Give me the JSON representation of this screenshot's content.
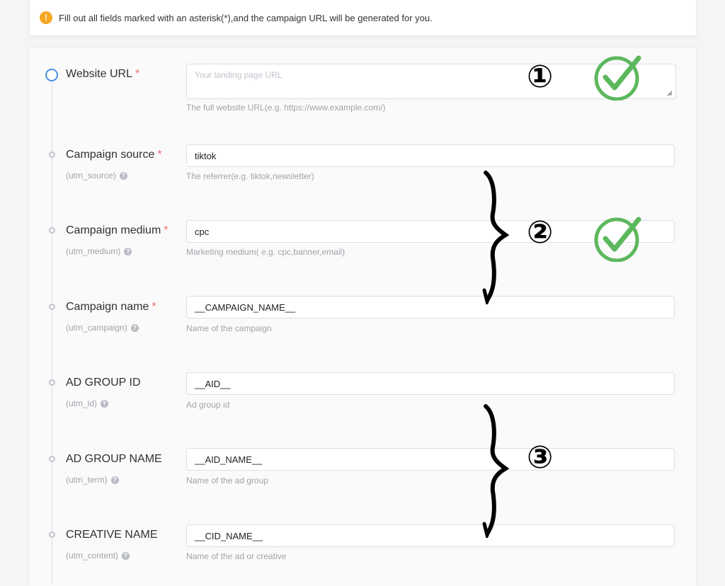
{
  "notice": {
    "icon": "exclamation-icon",
    "text": "Fill out all fields marked with an asterisk(*),and the campaign URL will be generated for you."
  },
  "fields": [
    {
      "label": "Website URL",
      "required": "*",
      "param": "",
      "value": "",
      "placeholder": "Your landing page URL",
      "hint": "The full website URL(e.g. https://www.example.com/)"
    },
    {
      "label": "Campaign source",
      "required": "*",
      "param": "(utm_source)",
      "value": "tiktok",
      "hint": "The referrer(e.g. tiktok,newsletter)"
    },
    {
      "label": "Campaign medium",
      "required": "*",
      "param": "(utm_medium)",
      "value": "cpc",
      "hint": "Marketing medium( e.g. cpc,banner,email)"
    },
    {
      "label": "Campaign name",
      "required": "*",
      "param": "(utm_campaign)",
      "value": "__CAMPAIGN_NAME__",
      "hint": "Name of the campaign"
    },
    {
      "label": "AD GROUP ID",
      "required": "",
      "param": "(utm_id)",
      "value": "__AID__",
      "hint": "Ad group id"
    },
    {
      "label": "AD GROUP NAME",
      "required": "",
      "param": "(utm_term)",
      "value": "__AID_NAME__",
      "hint": "Name of the ad group"
    },
    {
      "label": "CREATIVE NAME",
      "required": "",
      "param": "(utm_content)",
      "value": "__CID_NAME__",
      "hint": "Name of the ad or creative"
    }
  ],
  "help_icon": "?",
  "annotations": {
    "num1": "①",
    "num2": "②",
    "num3": "③",
    "check_color": "#5cb85c"
  }
}
